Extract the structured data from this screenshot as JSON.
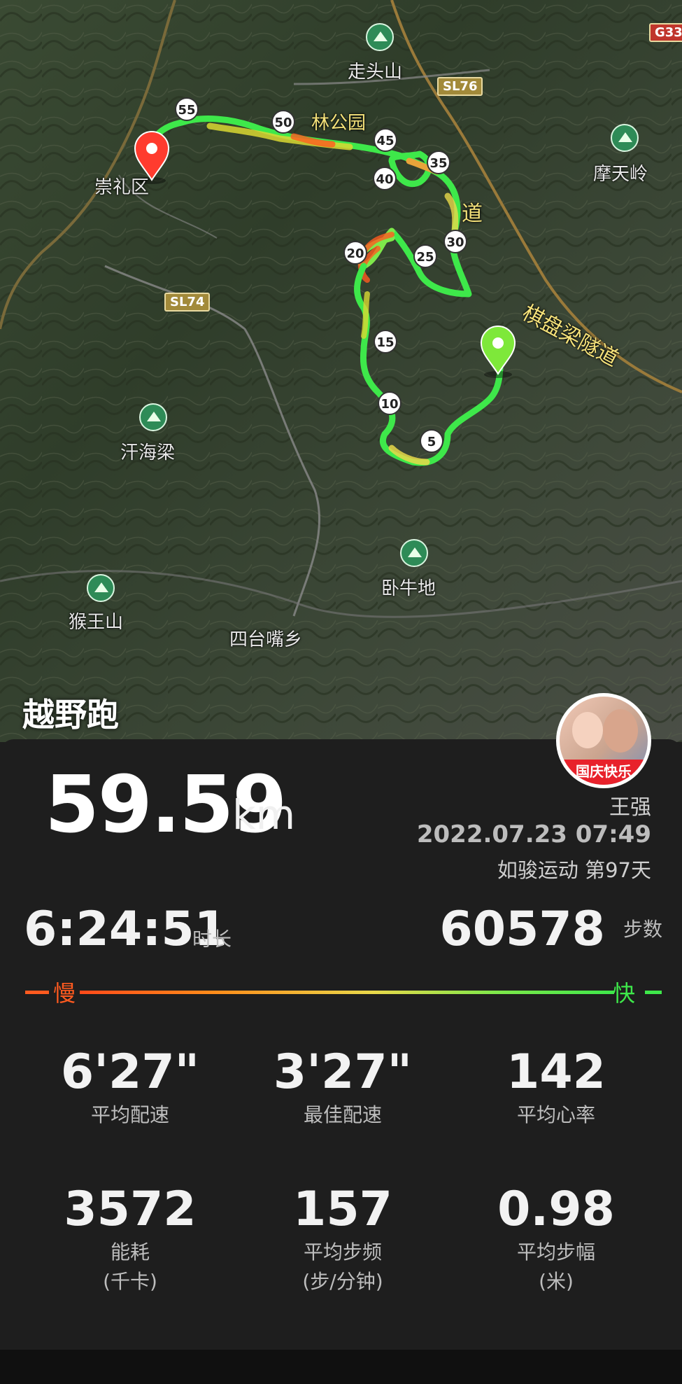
{
  "activity_title": "越野跑",
  "map_labels": {
    "county": "崇礼区",
    "peaks": [
      "走头山",
      "摩天岭",
      "汗海梁",
      "卧牛地",
      "猴王山"
    ],
    "town": "四台嘴乡",
    "road_shields": [
      "SL76",
      "SL74",
      "G33"
    ],
    "tunnel": "棋盘梁隧道",
    "park_fragment": "林公园",
    "road_fragment": "道"
  },
  "km_markers": [
    "5",
    "10",
    "15",
    "20",
    "25",
    "30",
    "35",
    "40",
    "45",
    "50",
    "55"
  ],
  "summary": {
    "distance": "59.59",
    "distance_unit": "km",
    "user_name": "王强",
    "datetime": "2022.07.23 07:49",
    "streak": "如骏运动 第97天",
    "avatar_banner": "国庆快乐"
  },
  "duration": {
    "value": "6:24:51",
    "label": "时长"
  },
  "steps": {
    "value": "60578",
    "label": "步数"
  },
  "pace_legend": {
    "slow": "慢",
    "fast": "快"
  },
  "stats": [
    {
      "value": "6'27\"",
      "label": "平均配速",
      "unit": ""
    },
    {
      "value": "3'27\"",
      "label": "最佳配速",
      "unit": ""
    },
    {
      "value": "142",
      "label": "平均心率",
      "unit": ""
    },
    {
      "value": "3572",
      "label": "能耗",
      "unit": "(千卡)"
    },
    {
      "value": "157",
      "label": "平均步频",
      "unit": "(步/分钟)"
    },
    {
      "value": "0.98",
      "label": "平均步幅",
      "unit": "(米)"
    }
  ],
  "colors": {
    "fast": "#3ee84a",
    "slow": "#ff5a1f",
    "start_pin": "#7ee83a",
    "end_pin": "#ff3b2e"
  }
}
